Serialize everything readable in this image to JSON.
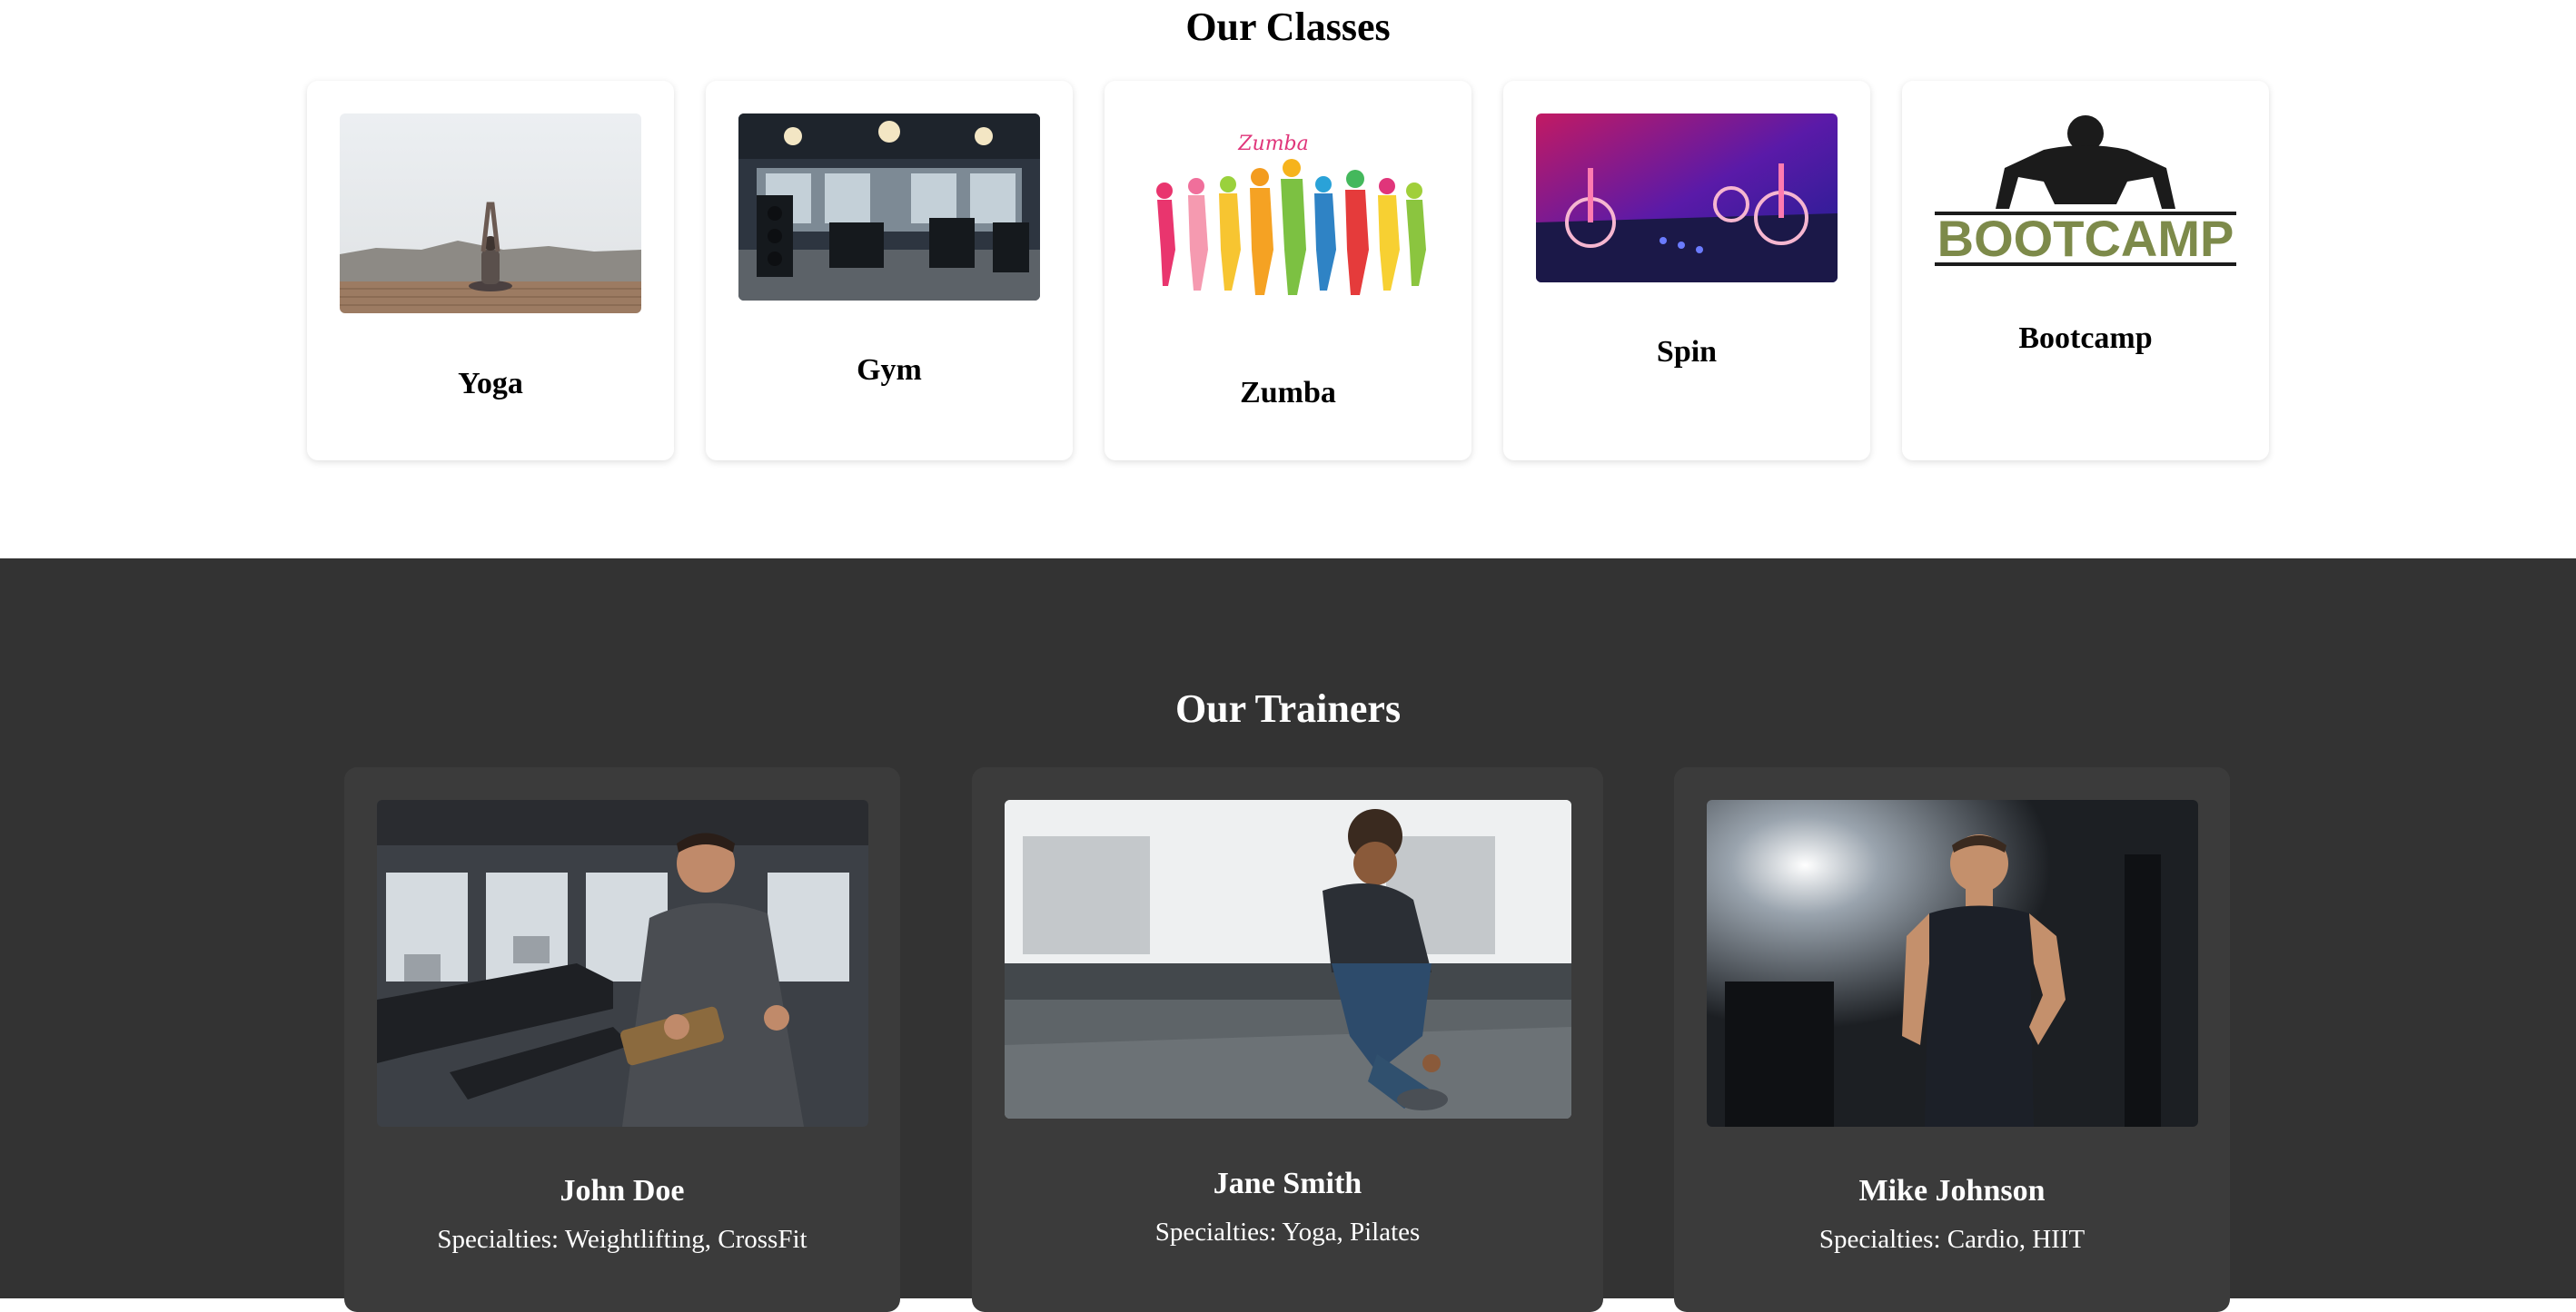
{
  "classes": {
    "title": "Our Classes",
    "items": [
      {
        "name": "Yoga"
      },
      {
        "name": "Gym"
      },
      {
        "name": "Zumba",
        "image_text": "Zumba"
      },
      {
        "name": "Spin"
      },
      {
        "name": "Bootcamp",
        "image_text": "BOOTCAMP"
      }
    ]
  },
  "trainers": {
    "title": "Our Trainers",
    "items": [
      {
        "name": "John Doe",
        "specialties": "Specialties: Weightlifting, CrossFit"
      },
      {
        "name": "Jane Smith",
        "specialties": "Specialties: Yoga, Pilates"
      },
      {
        "name": "Mike Johnson",
        "specialties": "Specialties: Cardio, HIIT"
      }
    ]
  },
  "colors": {
    "trainers_bg": "#333333",
    "card_bg_dark": "#3b3b3b",
    "bootcamp_green": "#7d8a4a"
  }
}
